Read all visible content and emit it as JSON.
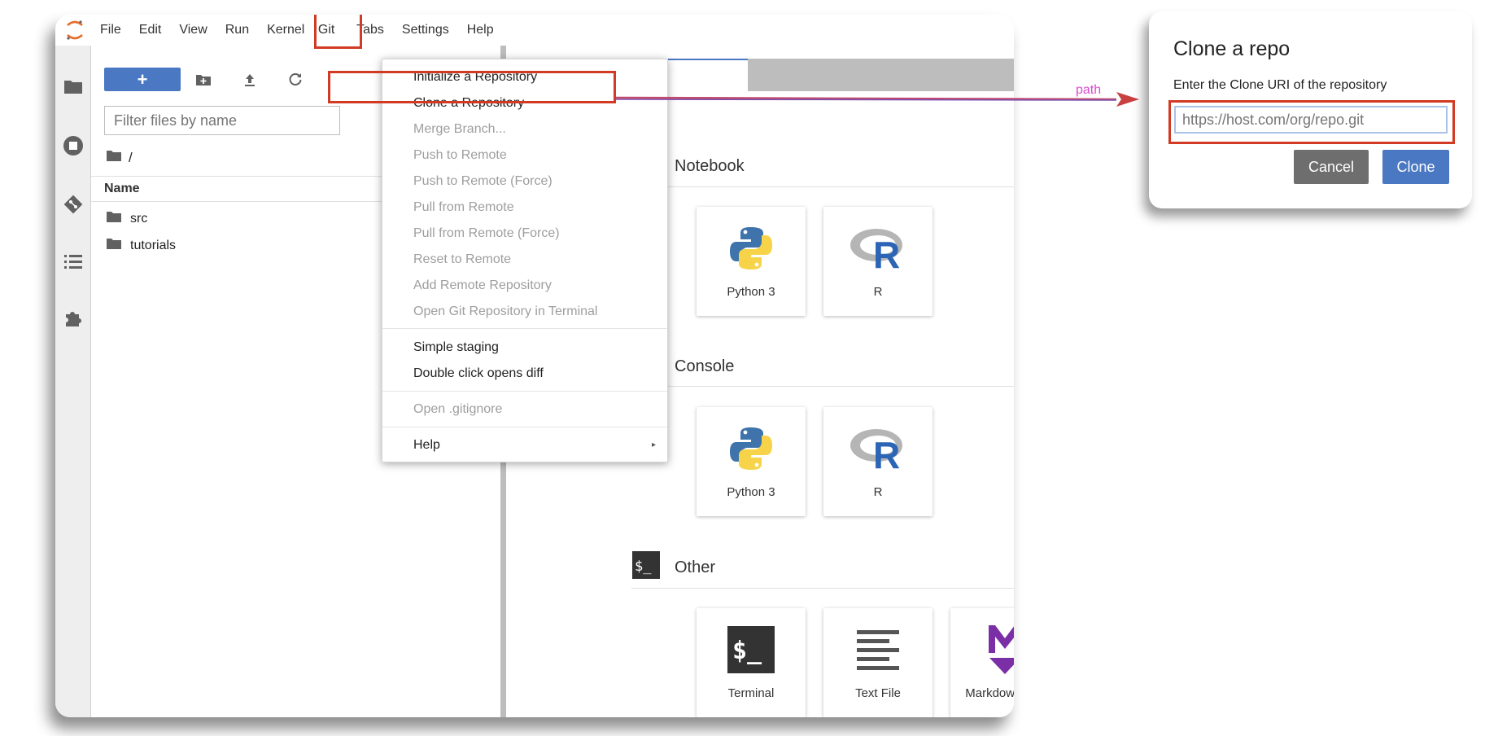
{
  "menubar": {
    "items": [
      "File",
      "Edit",
      "View",
      "Run",
      "Kernel",
      "Git",
      "Tabs",
      "Settings",
      "Help"
    ]
  },
  "filebrowser": {
    "new_label": "+",
    "filter_placeholder": "Filter files by name",
    "breadcrumb": "/",
    "column_name": "Name",
    "files": [
      {
        "name": "src",
        "icon": "folder-icon"
      },
      {
        "name": "tutorials",
        "icon": "folder-icon"
      }
    ]
  },
  "git_menu": {
    "items": [
      {
        "label": "Initialize a Repository",
        "enabled": true
      },
      {
        "label": "Clone a Repository",
        "enabled": true,
        "highlighted": true
      },
      {
        "label": "Merge Branch...",
        "enabled": false
      },
      {
        "label": "Push to Remote",
        "enabled": false
      },
      {
        "label": "Push to Remote (Force)",
        "enabled": false
      },
      {
        "label": "Pull from Remote",
        "enabled": false
      },
      {
        "label": "Pull from Remote (Force)",
        "enabled": false
      },
      {
        "label": "Reset to Remote",
        "enabled": false
      },
      {
        "label": "Add Remote Repository",
        "enabled": false
      },
      {
        "label": "Open Git Repository in Terminal",
        "enabled": false
      },
      {
        "label": "Simple staging",
        "enabled": true
      },
      {
        "label": "Double click opens diff",
        "enabled": true
      },
      {
        "label": "Open .gitignore",
        "enabled": false
      },
      {
        "label": "Help",
        "enabled": true,
        "submenu": true
      }
    ]
  },
  "launcher": {
    "sections": [
      {
        "title": "Notebook",
        "cards": [
          "Python 3",
          "R"
        ]
      },
      {
        "title": "Console",
        "cards": [
          "Python 3",
          "R"
        ]
      },
      {
        "title": "Other",
        "cards": [
          "Terminal",
          "Text File",
          "Markdown File"
        ]
      }
    ]
  },
  "annotation": {
    "arrow_label": "path"
  },
  "dialog": {
    "title": "Clone a repo",
    "prompt": "Enter the Clone URI of the repository",
    "input_placeholder": "https://host.com/org/repo.git",
    "cancel_label": "Cancel",
    "clone_label": "Clone"
  },
  "colors": {
    "accent": "#4a78c2",
    "highlight": "#d23a24",
    "jupyter_orange": "#e46e2e",
    "annotation": "#d94ad1"
  }
}
